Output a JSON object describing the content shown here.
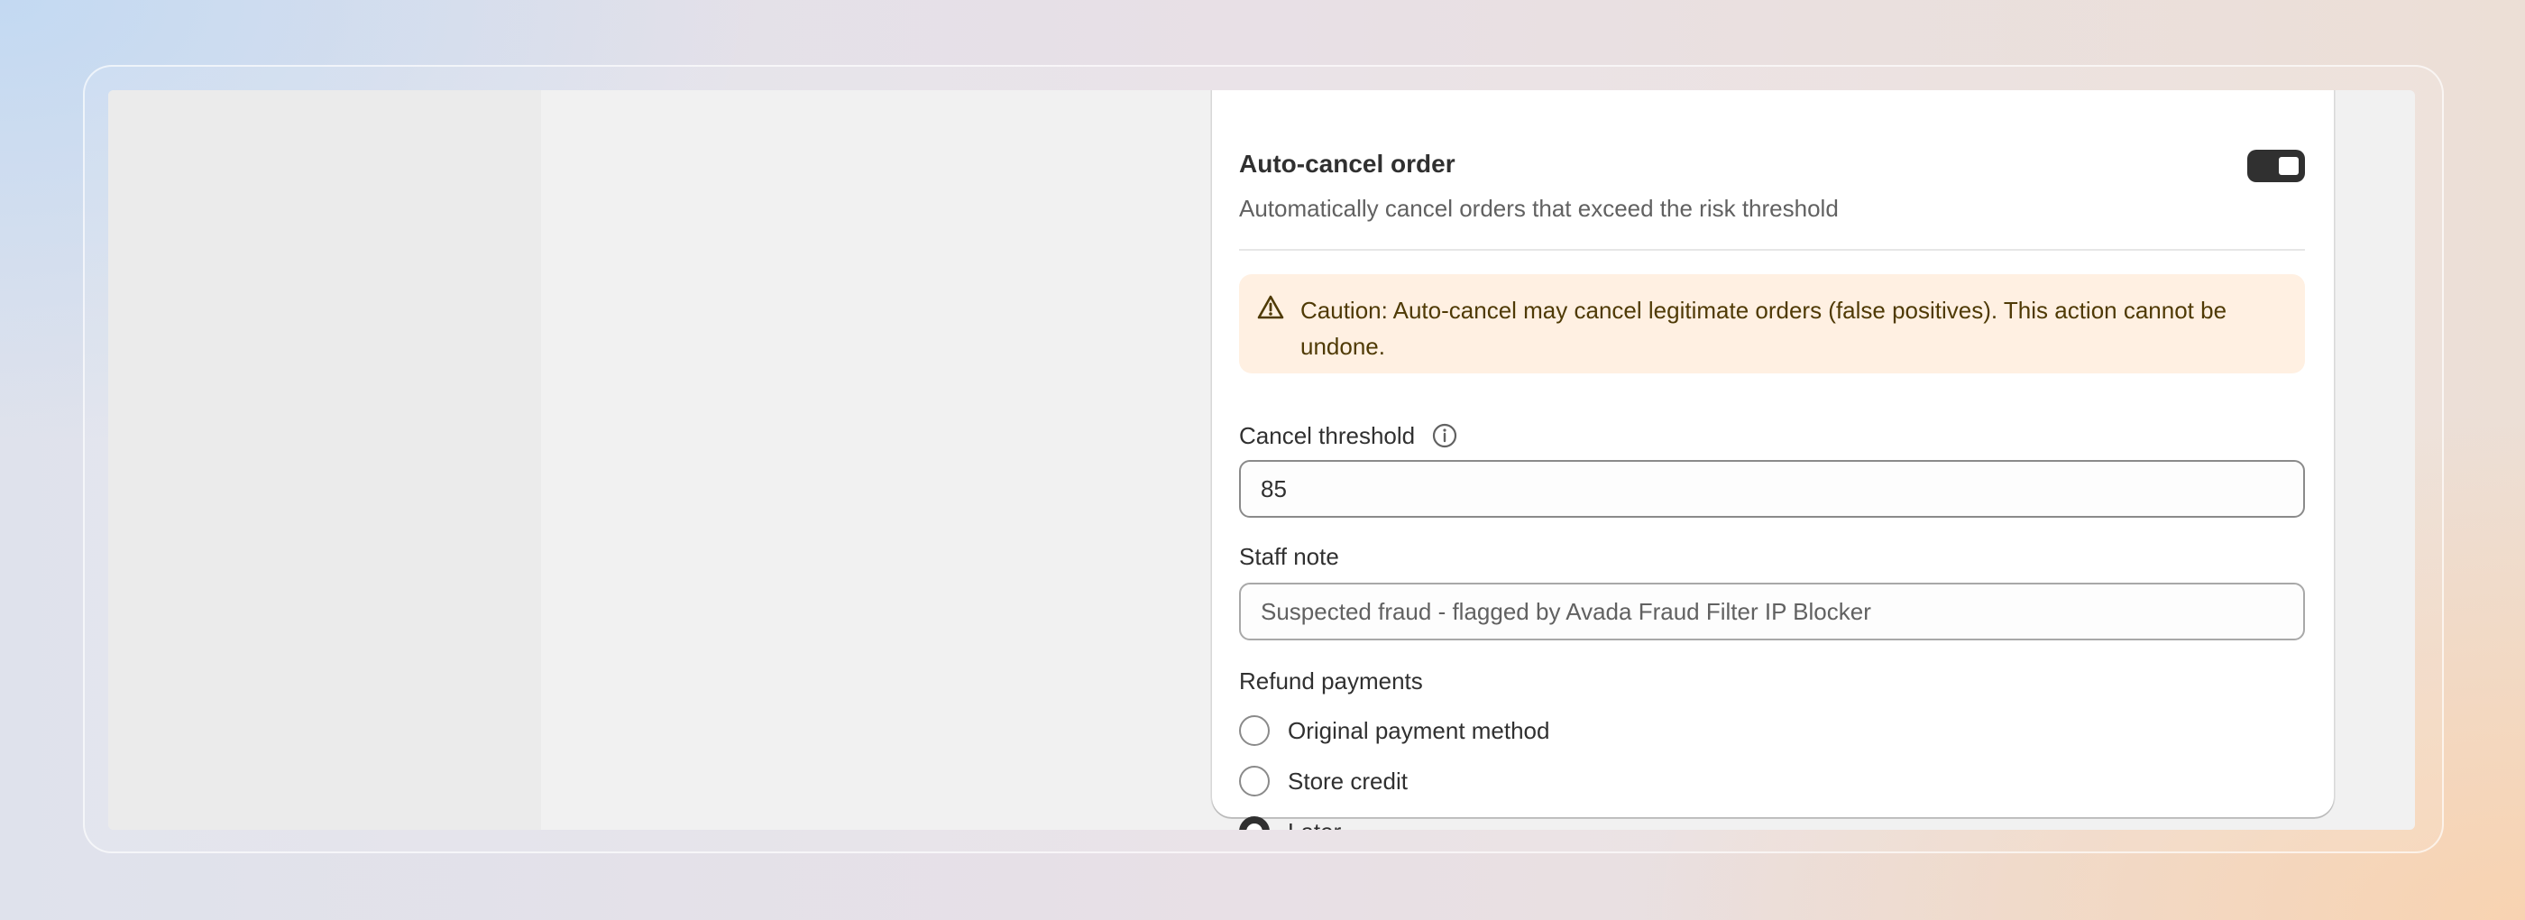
{
  "auto_cancel": {
    "title": "Auto-cancel order",
    "description": "Automatically cancel orders that exceed the risk threshold",
    "enabled": true
  },
  "caution": {
    "icon": "warning-triangle-icon",
    "text": "Caution: Auto-cancel may cancel legitimate orders (false positives). This action cannot be undone."
  },
  "cancel_threshold": {
    "label": "Cancel threshold",
    "info_icon": "info-icon",
    "value": "85"
  },
  "staff_note": {
    "label": "Staff note",
    "value": "Suspected fraud - flagged by Avada Fraud Filter IP Blocker"
  },
  "refund_payments": {
    "label": "Refund payments",
    "options": [
      {
        "label": "Original payment method",
        "selected": false
      },
      {
        "label": "Store credit",
        "selected": false
      },
      {
        "label": "Later",
        "selected": true
      }
    ]
  },
  "colors": {
    "toggle_on": "#303030",
    "banner_bg": "#fff0e2",
    "banner_text": "#4f3a05"
  }
}
